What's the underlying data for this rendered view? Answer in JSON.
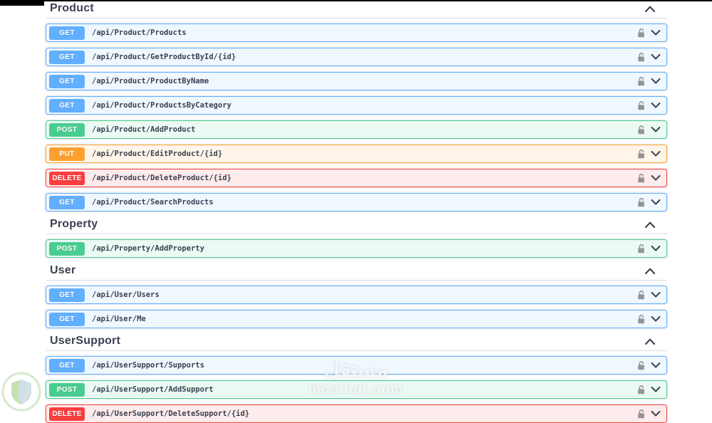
{
  "page": {
    "app": "Swagger UI API list",
    "background": "#ffffff",
    "text_color": "#3b4151",
    "header_divider_color": "#d9dde1"
  },
  "watermark": {
    "brand_arabic": "مستقل",
    "brand_domain": "mostaql.com"
  },
  "icons": {
    "section_collapse": "chevron-up-icon",
    "row_expand": "chevron-down-icon",
    "authorization": "unlock-icon",
    "corner_logo": "shield-logo-watermark"
  },
  "methods": {
    "GET": {
      "label": "GET",
      "badge_color": "#61affe",
      "row_bg": "rgba(97,175,254,0.1)",
      "border_color": "#61affe"
    },
    "POST": {
      "label": "POST",
      "badge_color": "#49cc90",
      "row_bg": "rgba(73,204,144,0.1)",
      "border_color": "#49cc90"
    },
    "PUT": {
      "label": "PUT",
      "badge_color": "#fca130",
      "row_bg": "rgba(252,161,48,0.1)",
      "border_color": "#fca130"
    },
    "DELETE": {
      "label": "DELETE",
      "badge_color": "#f93e3e",
      "row_bg": "rgba(249,62,62,0.1)",
      "border_color": "#f93e3e"
    }
  },
  "sections": [
    {
      "title": "Product",
      "expanded": true,
      "endpoints": [
        {
          "method": "GET",
          "path": "/api/Product/Products"
        },
        {
          "method": "GET",
          "path": "/api/Product/GetProductById/{id}"
        },
        {
          "method": "GET",
          "path": "/api/Product/ProductByName"
        },
        {
          "method": "GET",
          "path": "/api/Product/ProductsByCategory"
        },
        {
          "method": "POST",
          "path": "/api/Product/AddProduct"
        },
        {
          "method": "PUT",
          "path": "/api/Product/EditProduct/{id}"
        },
        {
          "method": "DELETE",
          "path": "/api/Product/DeleteProduct/{id}"
        },
        {
          "method": "GET",
          "path": "/api/Product/SearchProducts"
        }
      ]
    },
    {
      "title": "Property",
      "expanded": true,
      "endpoints": [
        {
          "method": "POST",
          "path": "/api/Property/AddProperty"
        }
      ]
    },
    {
      "title": "User",
      "expanded": true,
      "endpoints": [
        {
          "method": "GET",
          "path": "/api/User/Users"
        },
        {
          "method": "GET",
          "path": "/api/User/Me"
        }
      ]
    },
    {
      "title": "UserSupport",
      "expanded": true,
      "endpoints": [
        {
          "method": "GET",
          "path": "/api/UserSupport/Supports"
        },
        {
          "method": "POST",
          "path": "/api/UserSupport/AddSupport"
        },
        {
          "method": "DELETE",
          "path": "/api/UserSupport/DeleteSupport/{id}"
        }
      ]
    }
  ]
}
